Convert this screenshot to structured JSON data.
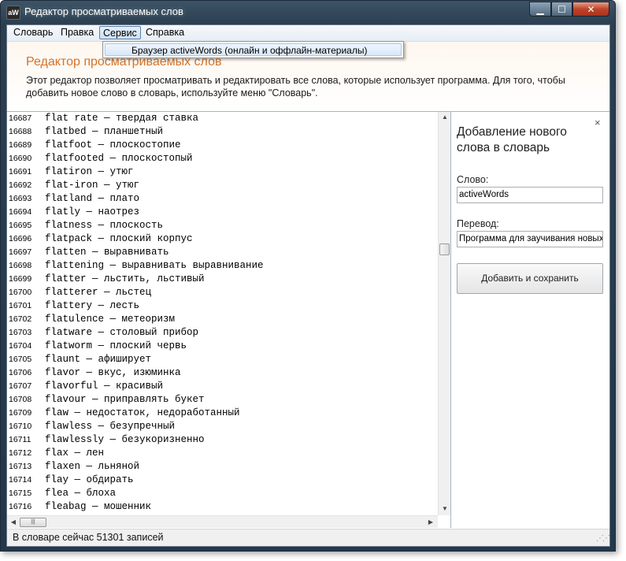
{
  "window": {
    "title": "Редактор просматриваемых слов",
    "icon_text": "aW",
    "controls": {
      "minimize": "▁",
      "maximize": "☐",
      "close": "✕"
    }
  },
  "menu": {
    "items": [
      "Словарь",
      "Правка",
      "Сервис",
      "Справка"
    ],
    "active_index": 2,
    "dropdown": {
      "items": [
        "Браузер activeWords (онлайн и оффлайн-материалы)"
      ]
    }
  },
  "header": {
    "title": "Редактор просматриваемых слов",
    "description": "Этот редактор позволяет просматривать и редактировать все слова, которые использует программа. Для того, чтобы добавить новое слово в словарь, используйте меню \"Словарь\"."
  },
  "words": [
    {
      "num": "16687",
      "text": "flat rate — твердая ставка"
    },
    {
      "num": "16688",
      "text": "flatbed — планшетный"
    },
    {
      "num": "16689",
      "text": "flatfoot — плоскостопие"
    },
    {
      "num": "16690",
      "text": "flatfooted — плоскостопый"
    },
    {
      "num": "16691",
      "text": "flatiron — утюг"
    },
    {
      "num": "16692",
      "text": "flat-iron — утюг"
    },
    {
      "num": "16693",
      "text": "flatland — плато"
    },
    {
      "num": "16694",
      "text": "flatly — наотрез"
    },
    {
      "num": "16695",
      "text": "flatness — плоскость"
    },
    {
      "num": "16696",
      "text": "flatpack — плоский корпус"
    },
    {
      "num": "16697",
      "text": "flatten — выравнивать"
    },
    {
      "num": "16698",
      "text": "flattening — выравнивать выравнивание"
    },
    {
      "num": "16699",
      "text": "flatter — льстить, льстивый"
    },
    {
      "num": "16700",
      "text": "flatterer — льстец"
    },
    {
      "num": "16701",
      "text": "flattery — лесть"
    },
    {
      "num": "16702",
      "text": "flatulence — метеоризм"
    },
    {
      "num": "16703",
      "text": "flatware — столовый прибор"
    },
    {
      "num": "16704",
      "text": "flatworm — плоский червь"
    },
    {
      "num": "16705",
      "text": "flaunt — афиширует"
    },
    {
      "num": "16706",
      "text": "flavor — вкус, изюминка"
    },
    {
      "num": "16707",
      "text": "flavorful — красивый"
    },
    {
      "num": "16708",
      "text": "flavour — приправлять букет"
    },
    {
      "num": "16709",
      "text": "flaw — недостаток, недоработанный"
    },
    {
      "num": "16710",
      "text": "flawless — безупречный"
    },
    {
      "num": "16711",
      "text": "flawlessly — безукоризненно"
    },
    {
      "num": "16712",
      "text": "flax — лен"
    },
    {
      "num": "16713",
      "text": "flaxen — льняной"
    },
    {
      "num": "16714",
      "text": "flay — обдирать"
    },
    {
      "num": "16715",
      "text": "flea — блоха"
    },
    {
      "num": "16716",
      "text": "fleabag — мошенник"
    }
  ],
  "side_panel": {
    "close": "×",
    "title": "Добавление нового слова в словарь",
    "word_label": "Слово:",
    "word_value": "activeWords",
    "translation_label": "Перевод:",
    "translation_value": "Программа для заучивания новых а",
    "add_button": "Добавить и сохранить"
  },
  "status": {
    "text": "В словаре сейчас 51301 записей"
  },
  "colors": {
    "header_title": "#d4732a",
    "title_bar": "#2b3f50"
  }
}
